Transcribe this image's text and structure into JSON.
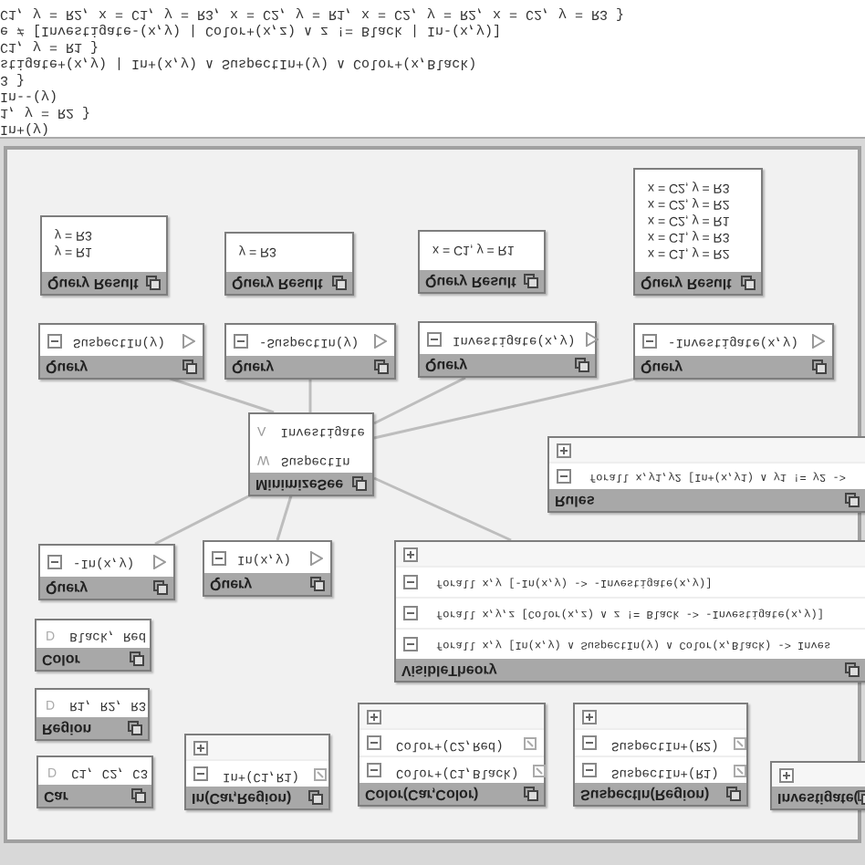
{
  "console": {
    "lines": [
      "C1, y = R2, x = C1, y = R3, x = C2, y = R1, x = C2, y = R2, x = C2, y = R3 }",
      "e ≠ [Investigate-(x,y) | Color+(x,z) ∧ z != Black | In-(x,y)]",
      "C1, y = R1 }",
      "stigate+(x,y) | In+(x,y) ∧ SuspectIn+(y) ∧ Color+(x,Black)",
      "3 }",
      "In--(y)",
      "1, y = R2 }",
      "In+(y)"
    ]
  },
  "query_results": [
    {
      "title": "Query Result",
      "lines": [
        "y = R3",
        "y = R1"
      ]
    },
    {
      "title": "Query Result",
      "lines": [
        "y = R3"
      ]
    },
    {
      "title": "Query Result",
      "lines": [
        "x = C1, y = R1"
      ]
    },
    {
      "title": "Query Result",
      "lines": [
        "x = C2, y = R3",
        "x = C2, y = R2",
        "x = C2, y = R1",
        "x = C1, y = R3",
        "x = C1, y = R2"
      ]
    }
  ],
  "queries": [
    {
      "title": "Query",
      "expression": "SuspectIn(y)"
    },
    {
      "title": "Query",
      "expression": "-SuspectIn(y)"
    },
    {
      "title": "Query",
      "expression": "Investigate(x,y)"
    },
    {
      "title": "Query",
      "expression": "-Investigate(x,y)"
    },
    {
      "title": "Query",
      "expression": "-In(x,y)"
    },
    {
      "title": "Query",
      "expression": "In(x,y)"
    }
  ],
  "minimize": {
    "title": "MinimizeSee",
    "items": [
      {
        "marker": "Λ",
        "label": "Investigate"
      },
      {
        "marker": "W",
        "label": "SuspectIn"
      }
    ]
  },
  "rules": {
    "title": "Rules",
    "rows": [
      "forall x,y1,y2 [In+(x,y1) ∧ y1 != y2 ->"
    ]
  },
  "visible_theory": {
    "title": "VisibleTheory",
    "rows": [
      "forall x,y [-In(x,y) -> -Investigate(x,y)]",
      "forall x,y,z [Color(x,z) ∧ z != Black -> -Investigate(x,y)]",
      "forall x,y [In(x,y) ∧ SuspectIn(y) ∧ Color(x,Black) -> Inves"
    ]
  },
  "domains": [
    {
      "title": "Color",
      "marker": "D",
      "value": "Black, Red"
    },
    {
      "title": "Region",
      "marker": "D",
      "value": "R1, R2, R3"
    },
    {
      "title": "Car",
      "marker": "D",
      "value": "C1, C2, C3"
    }
  ],
  "predicates": [
    {
      "title": "In(Car,Region)",
      "facts": [
        "In+(C1,R1)"
      ]
    },
    {
      "title": "Color(Car,Color)",
      "facts": [
        "Color+(C2,Red)",
        "Color+(C1,Black)"
      ]
    },
    {
      "title": "SuspectIn(Region)",
      "facts": [
        "SuspectIn+(R2)",
        "SuspectIn+(R1)"
      ]
    },
    {
      "title": "Investigate("
    }
  ]
}
